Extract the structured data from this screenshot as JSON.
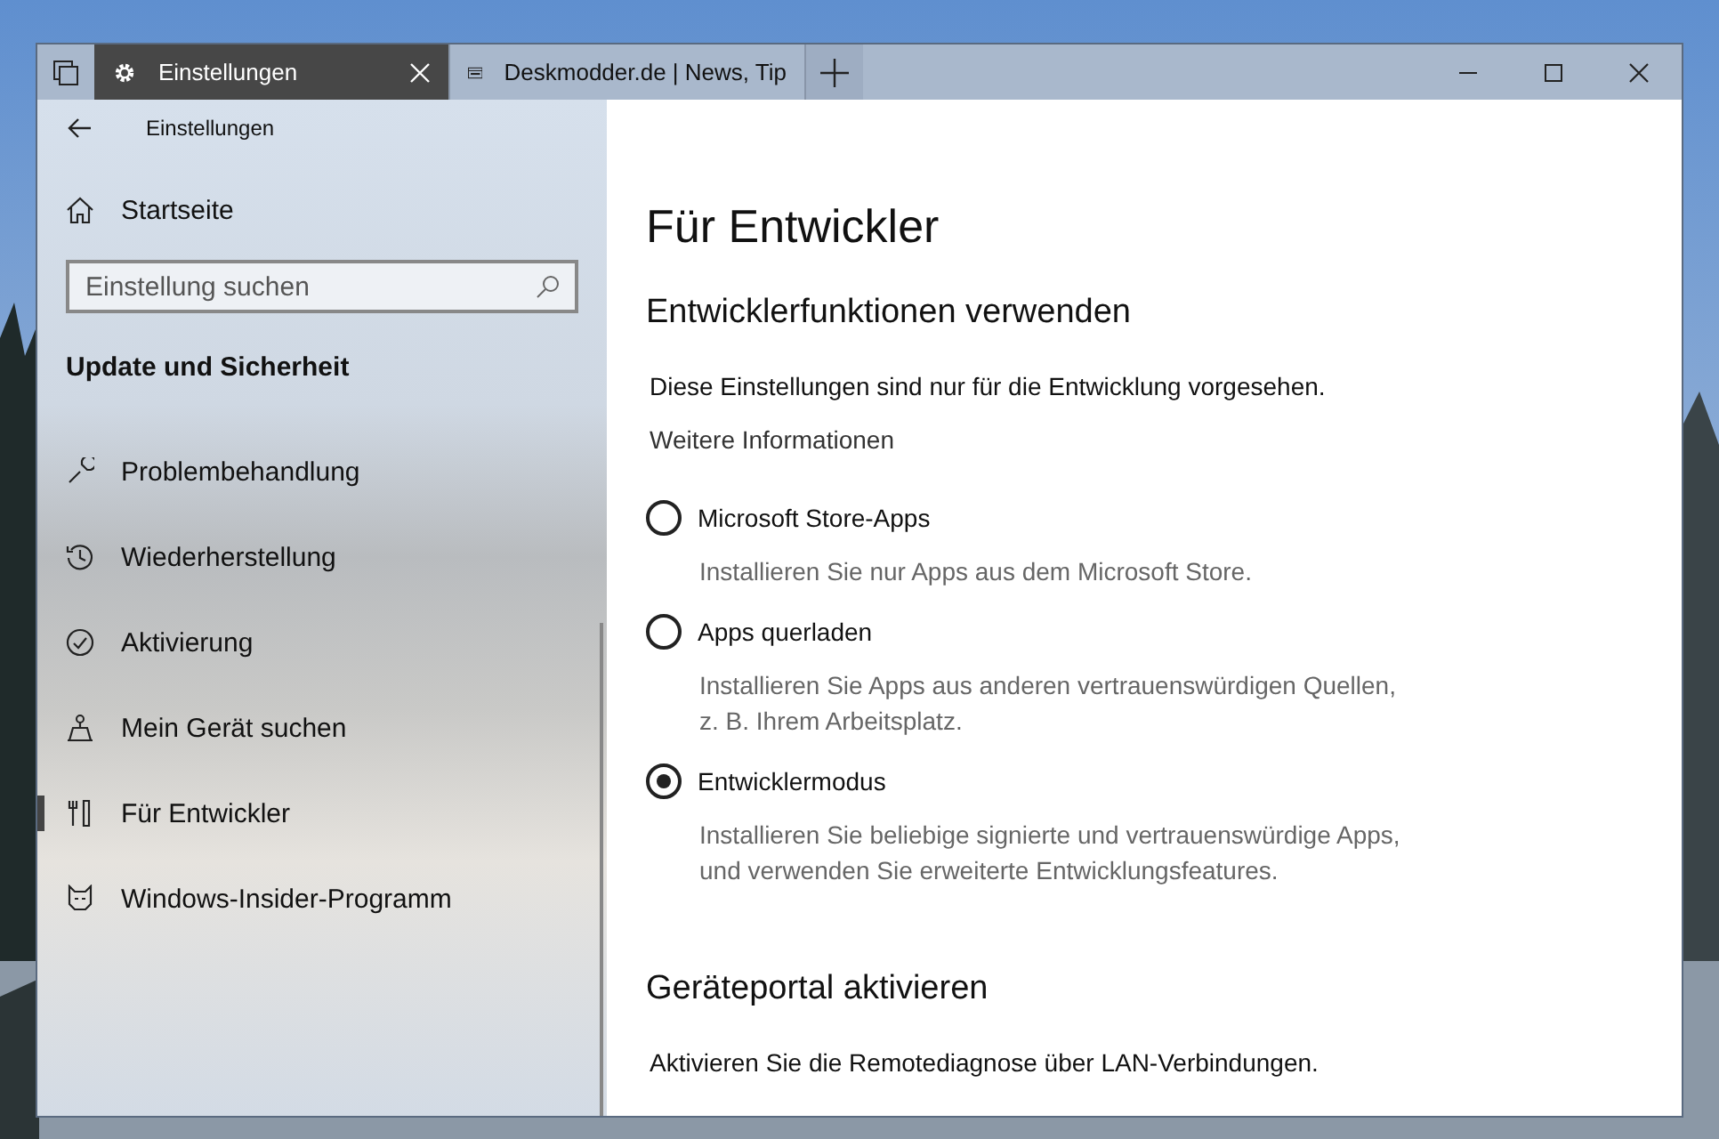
{
  "window": {
    "tabs": [
      {
        "kind": "settings",
        "label": "Einstellungen",
        "selected": true
      },
      {
        "kind": "web",
        "label": "Deskmodder.de | News, Tip",
        "selected": false
      }
    ]
  },
  "sidebar": {
    "app_title": "Einstellungen",
    "home": "Startseite",
    "search": {
      "placeholder": "Einstellung suchen"
    },
    "section_title": "Update und Sicherheit",
    "items": [
      {
        "label": "Problembehandlung",
        "selected": false
      },
      {
        "label": "Wiederherstellung",
        "selected": false
      },
      {
        "label": "Aktivierung",
        "selected": false
      },
      {
        "label": "Mein Gerät suchen",
        "selected": false
      },
      {
        "label": "Für Entwickler",
        "selected": true
      },
      {
        "label": "Windows-Insider-Programm",
        "selected": false
      }
    ]
  },
  "main": {
    "title": "Für Entwickler",
    "section_1": {
      "heading": "Entwicklerfunktionen verwenden",
      "text": "Diese Einstellungen sind nur für die Entwicklung vorgesehen.",
      "link": "Weitere Informationen",
      "options": [
        {
          "label": "Microsoft Store-Apps",
          "description": [
            "Installieren Sie nur Apps aus dem Microsoft Store."
          ],
          "selected": false
        },
        {
          "label": "Apps querladen",
          "description": [
            "Installieren Sie Apps aus anderen vertrauenswürdigen Quellen,",
            "z. B. Ihrem Arbeitsplatz."
          ],
          "selected": false
        },
        {
          "label": "Entwicklermodus",
          "description": [
            "Installieren Sie beliebige signierte und vertrauenswürdige Apps,",
            "und verwenden Sie erweiterte Entwicklungsfeatures."
          ],
          "selected": true
        }
      ]
    },
    "section_2": {
      "heading": "Geräteportal aktivieren",
      "text": "Aktivieren Sie die Remotediagnose über LAN-Verbindungen."
    }
  }
}
